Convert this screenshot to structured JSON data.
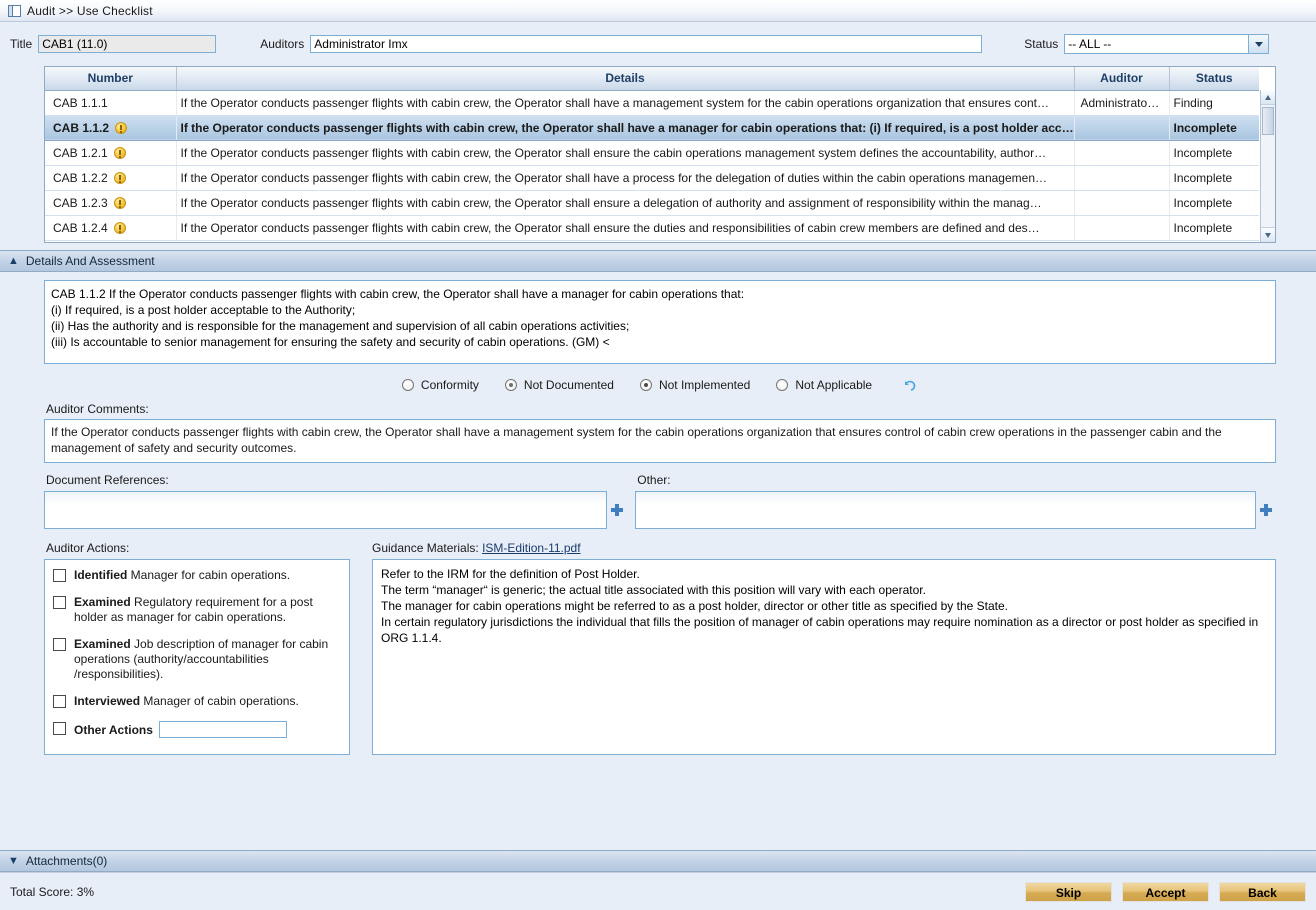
{
  "breadcrumb": {
    "icon": "window-icon",
    "text": "Audit >> Use Checklist"
  },
  "form": {
    "title_label": "Title",
    "title_value": "CAB1 (11.0)",
    "auditors_label": "Auditors",
    "auditors_value": "Administrator Imx",
    "status_label": "Status",
    "status_value": "-- ALL --"
  },
  "grid": {
    "columns": [
      "Number",
      "Details",
      "Auditor",
      "Status"
    ],
    "rows": [
      {
        "number": "CAB 1.1.1",
        "flag": false,
        "details": "If the Operator conducts passenger flights with cabin crew, the Operator shall have a management system for the cabin operations organization that ensures cont…",
        "auditor": "Administrato…",
        "status": "Finding",
        "selected": false
      },
      {
        "number": "CAB 1.1.2",
        "flag": true,
        "details": "If the Operator conducts passenger flights with cabin crew, the Operator shall have a manager for cabin operations that: (i) If required, is a post holder acc…",
        "auditor": "",
        "status": "Incomplete",
        "selected": true
      },
      {
        "number": "CAB 1.2.1",
        "flag": true,
        "details": "If the Operator conducts passenger flights with cabin crew, the Operator shall ensure the cabin operations management system defines the accountability, author…",
        "auditor": "",
        "status": "Incomplete",
        "selected": false
      },
      {
        "number": "CAB 1.2.2",
        "flag": true,
        "details": "If the Operator conducts passenger flights with cabin crew, the Operator shall have a process for the delegation of duties within the cabin operations managemen…",
        "auditor": "",
        "status": "Incomplete",
        "selected": false
      },
      {
        "number": "CAB 1.2.3",
        "flag": true,
        "details": "If the Operator conducts passenger flights with cabin crew, the Operator shall ensure a delegation of authority and assignment of responsibility within the manag…",
        "auditor": "",
        "status": "Incomplete",
        "selected": false
      },
      {
        "number": "CAB 1.2.4",
        "flag": true,
        "details": "If the Operator conducts passenger flights with cabin crew, the Operator shall ensure the duties and responsibilities of cabin crew members are defined and des…",
        "auditor": "",
        "status": "Incomplete",
        "selected": false
      }
    ]
  },
  "details_section": {
    "header": "Details And Assessment",
    "standard_text": "CAB 1.1.2  If the Operator conducts passenger flights with cabin crew, the Operator shall have a manager for cabin operations that:\n(i) If required, is a post holder acceptable to the Authority;\n(ii) Has the authority and is responsible for the management and supervision of all cabin operations activities;\n(iii) Is accountable to senior management for ensuring the safety and security of cabin operations. (GM) <",
    "assessment_options": [
      {
        "label": "Conformity",
        "selected": false
      },
      {
        "label": "Not Documented",
        "selected": true
      },
      {
        "label": "Not Implemented",
        "selected": true
      },
      {
        "label": "Not Applicable",
        "selected": false
      }
    ],
    "undo_icon": "undo-arrow-icon",
    "comments_label": "Auditor Comments:",
    "comments_value": "If the Operator conducts passenger flights with cabin crew, the Operator shall have a management system for the cabin operations organization that ensures control of cabin crew operations in the passenger cabin and the management of safety and security outcomes.",
    "doc_refs_label": "Document References:",
    "doc_refs_value": "",
    "other_label": "Other:",
    "other_value": "",
    "add_icon": "plus-icon"
  },
  "auditor_actions": {
    "label": "Auditor Actions:",
    "items": [
      {
        "bold": "Identified",
        "text": "Manager for cabin operations.",
        "checked": false,
        "input": false
      },
      {
        "bold": "Examined",
        "text": "Regulatory requirement for a post holder as manager for cabin operations.",
        "checked": false,
        "input": false
      },
      {
        "bold": "Examined",
        "text": "Job description of manager for cabin operations (authority/accountabilities /responsibilities).",
        "checked": false,
        "input": false
      },
      {
        "bold": "Interviewed",
        "text": "Manager of cabin operations.",
        "checked": false,
        "input": false
      },
      {
        "bold": "Other Actions",
        "text": "",
        "checked": false,
        "input": true,
        "input_value": ""
      }
    ]
  },
  "guidance": {
    "label": "Guidance Materials:",
    "link": "ISM-Edition-11.pdf",
    "text": "Refer to the IRM for the definition of Post Holder.\nThe term “manager“ is generic; the actual title associated with this position will vary with each operator.\nThe manager for cabin operations might be referred to as a post holder, director or other title as specified by the State.\nIn certain regulatory jurisdictions the individual that fills the position of manager of cabin operations may require nomination as a director or post holder as specified in ORG 1.1.4."
  },
  "attachments": {
    "header": "Attachments(0)"
  },
  "footer": {
    "score_label": "Total Score:",
    "score_value": "3%",
    "buttons": [
      "Skip",
      "Accept",
      "Back"
    ]
  },
  "colors": {
    "accent": "#1d3f66",
    "finding": "#d61414",
    "button": "#d6ab53",
    "flag": "#f7c63c",
    "link": "#1a3c6b"
  }
}
